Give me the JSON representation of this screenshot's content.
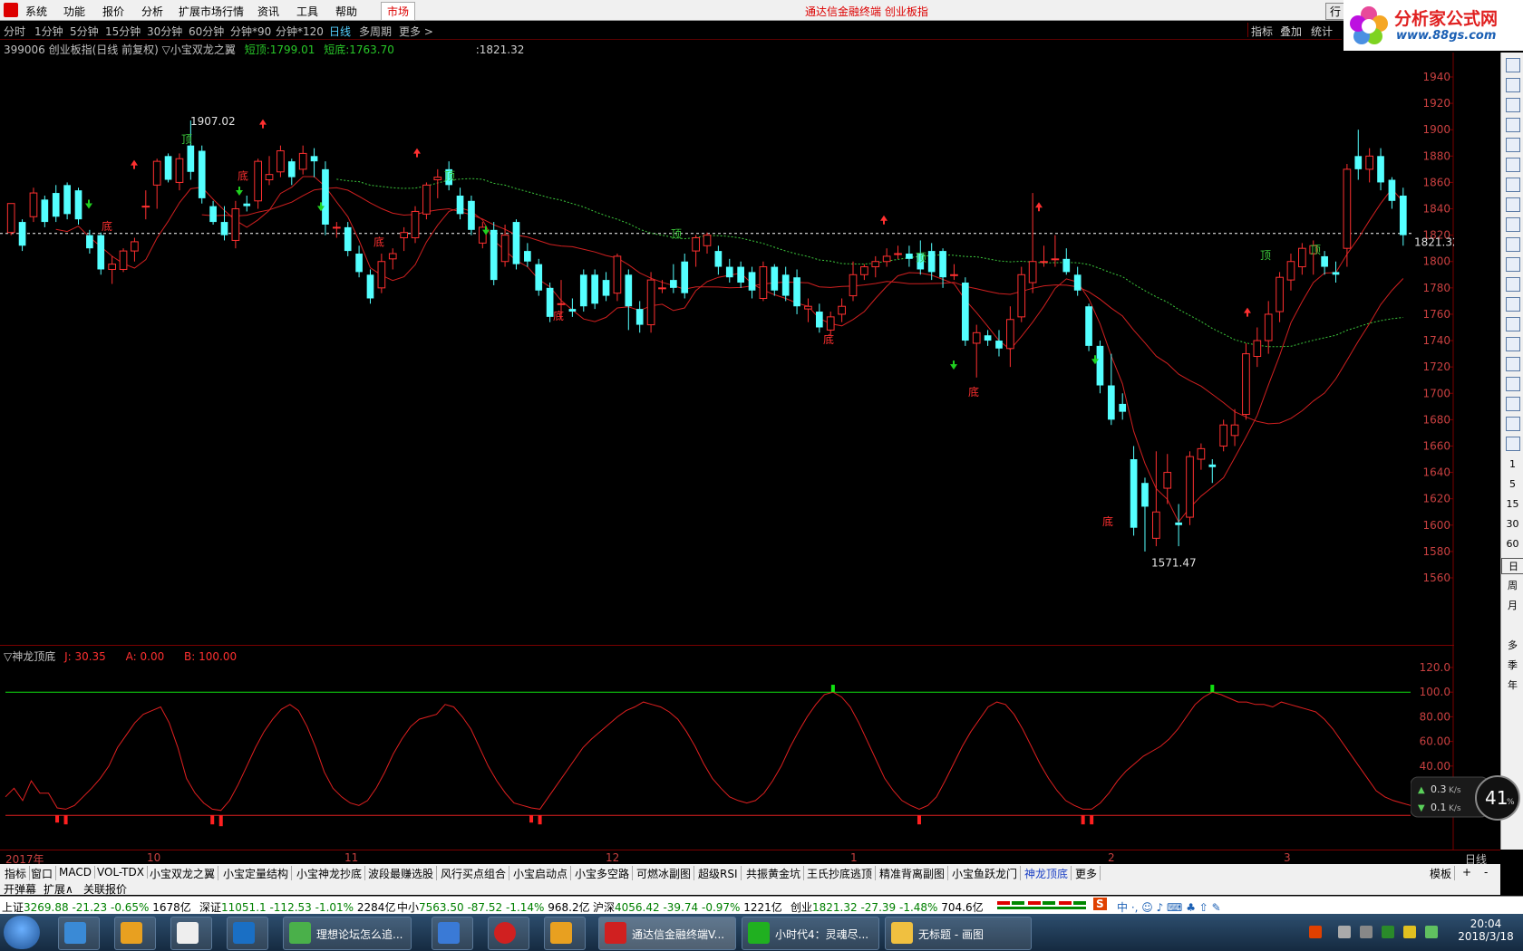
{
  "menubar": {
    "items": [
      "系统",
      "功能",
      "报价",
      "分析",
      "扩展市场行情",
      "资讯",
      "工具",
      "帮助"
    ],
    "market": "市场",
    "title": "通达信金融终端 创业板指",
    "quote_btn": "行"
  },
  "brand": {
    "name": "分析家公式网",
    "url": "www.88gs.com"
  },
  "periods": [
    "分时",
    "1分钟",
    "5分钟",
    "15分钟",
    "30分钟",
    "60分钟",
    "分钟*90",
    "分钟*120",
    "日线",
    "多周期",
    "更多 >"
  ],
  "active_period": "日线",
  "top_tools": [
    "指标",
    "叠加",
    "统计"
  ],
  "info": {
    "symbol": "399006 创业板指(日线 前复权) ▽小宝双龙之翼",
    "short_top_label": "短顶:",
    "short_top": "1799.01",
    "short_bottom_label": "短底:",
    "short_bottom": "1763.70",
    "cursor_value": ":1821.32"
  },
  "price_axis": {
    "ticks": [
      "1940",
      "1920",
      "1900",
      "1880",
      "1860",
      "1840",
      "1820",
      "1800",
      "1780",
      "1760",
      "1740",
      "1720",
      "1700",
      "1680",
      "1660",
      "1640",
      "1620",
      "1600",
      "1580",
      "1560"
    ],
    "current": "1821.32"
  },
  "annotations": {
    "high": "1907.02",
    "low": "1571.47",
    "top": "顶",
    "bottom": "底"
  },
  "indicator": {
    "name": "▽神龙顶底",
    "j": "J: 30.35",
    "a": "A: 0.00",
    "b": "B: 100.00",
    "ticks": [
      "120.0",
      "100.0",
      "80.00",
      "60.00",
      "40.00",
      "20.00"
    ]
  },
  "date_axis": {
    "labels": [
      "2017年",
      "10",
      "11",
      "12",
      "1",
      "2",
      "3"
    ],
    "period": "日线"
  },
  "indicator_tabs": [
    "指标",
    "窗口",
    "MACD",
    "VOL-TDX",
    "小宝双龙之翼",
    "小宝定量结构",
    "小宝神龙抄底",
    "波段最赚选股",
    "风行买点组合",
    "小宝启动点",
    "小宝多空路",
    "可燃冰副图",
    "超级RSI",
    "共振黄金坑",
    "王氏抄底逃顶",
    "精准背离副图",
    "小宝鱼跃龙门",
    "神龙顶底",
    "更多"
  ],
  "active_tab": "神龙顶底",
  "tabs_right": [
    "模板",
    "+",
    "-"
  ],
  "sub_tabs": [
    "开弹幕",
    "扩展∧",
    "关联报价"
  ],
  "right_tool_labels": [
    "1",
    "5",
    "15",
    "30",
    "60",
    "日",
    "周",
    "月",
    "多",
    "季",
    "年"
  ],
  "status": [
    {
      "name": "上证",
      "value": "3269.88",
      "chg": "-21.23",
      "pct": "-0.65%",
      "amt": "1678亿"
    },
    {
      "name": "深证",
      "value": "11051.1",
      "chg": "-112.53",
      "pct": "-1.01%",
      "amt": "2284亿"
    },
    {
      "name": "中小",
      "value": "7563.50",
      "chg": "-87.52",
      "pct": "-1.14%",
      "amt": "968.2亿"
    },
    {
      "name": "沪深",
      "value": "4056.42",
      "chg": "-39.74",
      "pct": "-0.97%",
      "amt": "1221亿"
    },
    {
      "name": "创业",
      "value": "1821.32",
      "chg": "-27.39",
      "pct": "-1.48%",
      "amt": "704.6亿"
    }
  ],
  "netspeed": {
    "up": "0.3",
    "down": "0.1",
    "unit": "K/s",
    "percent": "41",
    "sign": "%"
  },
  "taskbar": {
    "windows": [
      "理想论坛怎么追...",
      "通达信金融终端V...",
      "小时代4：灵魂尽...",
      "无标题 - 画图"
    ],
    "time": "20:04",
    "date": "2018/3/18"
  },
  "colors": {
    "up": "#ff3030",
    "down": "#54ffff",
    "ma": "#d02020",
    "dash": "#3cc83c",
    "kdj": "#e02020",
    "ref": "#10e010"
  },
  "chart_data": {
    "type": "candlestick",
    "ylim": [
      1550,
      1950
    ],
    "candles": [
      [
        1822,
        1844,
        1838,
        1820
      ],
      [
        1830,
        1812,
        1808,
        1832
      ],
      [
        1834,
        1852,
        1856,
        1830
      ],
      [
        1847,
        1830,
        1826,
        1850
      ],
      [
        1852,
        1834,
        1830,
        1858
      ],
      [
        1858,
        1836,
        1832,
        1860
      ],
      [
        1854,
        1832,
        1828,
        1856
      ],
      [
        1820,
        1810,
        1806,
        1824
      ],
      [
        1820,
        1794,
        1790,
        1822
      ],
      [
        1794,
        1798,
        1783,
        1804
      ],
      [
        1794,
        1808,
        1792,
        1810
      ],
      [
        1808,
        1815,
        1800,
        1818
      ],
      [
        1842,
        1842,
        1832,
        1854
      ],
      [
        1858,
        1876,
        1840,
        1878
      ],
      [
        1880,
        1862,
        1860,
        1882
      ],
      [
        1860,
        1878,
        1854,
        1882
      ],
      [
        1888,
        1868,
        1862,
        1907
      ],
      [
        1884,
        1848,
        1844,
        1888
      ],
      [
        1842,
        1830,
        1828,
        1846
      ],
      [
        1830,
        1820,
        1816,
        1842
      ],
      [
        1816,
        1840,
        1810,
        1846
      ],
      [
        1844,
        1842,
        1838,
        1850
      ],
      [
        1846,
        1876,
        1840,
        1878
      ],
      [
        1862,
        1866,
        1858,
        1880
      ],
      [
        1868,
        1884,
        1864,
        1888
      ],
      [
        1876,
        1864,
        1858,
        1878
      ],
      [
        1870,
        1882,
        1866,
        1888
      ],
      [
        1880,
        1876,
        1864,
        1886
      ],
      [
        1870,
        1828,
        1820,
        1876
      ],
      [
        1826,
        1826,
        1818,
        1830
      ],
      [
        1826,
        1808,
        1804,
        1830
      ],
      [
        1806,
        1792,
        1788,
        1812
      ],
      [
        1790,
        1772,
        1768,
        1794
      ],
      [
        1780,
        1800,
        1776,
        1806
      ],
      [
        1802,
        1806,
        1794,
        1810
      ],
      [
        1818,
        1822,
        1808,
        1826
      ],
      [
        1818,
        1838,
        1814,
        1842
      ],
      [
        1836,
        1858,
        1832,
        1860
      ],
      [
        1862,
        1864,
        1848,
        1870
      ],
      [
        1870,
        1858,
        1854,
        1876
      ],
      [
        1850,
        1836,
        1832,
        1856
      ],
      [
        1846,
        1824,
        1820,
        1850
      ],
      [
        1814,
        1826,
        1810,
        1830
      ],
      [
        1824,
        1786,
        1782,
        1830
      ],
      [
        1800,
        1820,
        1796,
        1828
      ],
      [
        1830,
        1798,
        1794,
        1832
      ],
      [
        1808,
        1800,
        1796,
        1814
      ],
      [
        1798,
        1778,
        1774,
        1802
      ],
      [
        1780,
        1758,
        1754,
        1784
      ],
      [
        1768,
        1768,
        1756,
        1786
      ],
      [
        1764,
        1762,
        1758,
        1772
      ],
      [
        1790,
        1766,
        1762,
        1794
      ],
      [
        1790,
        1768,
        1764,
        1794
      ],
      [
        1786,
        1774,
        1770,
        1792
      ],
      [
        1776,
        1804,
        1770,
        1806
      ],
      [
        1790,
        1766,
        1748,
        1794
      ],
      [
        1764,
        1752,
        1746,
        1770
      ],
      [
        1752,
        1786,
        1746,
        1792
      ],
      [
        1780,
        1780,
        1776,
        1786
      ],
      [
        1786,
        1780,
        1776,
        1798
      ],
      [
        1800,
        1776,
        1772,
        1806
      ],
      [
        1808,
        1818,
        1796,
        1820
      ],
      [
        1812,
        1820,
        1806,
        1822
      ],
      [
        1808,
        1796,
        1790,
        1812
      ],
      [
        1796,
        1788,
        1784,
        1802
      ],
      [
        1796,
        1784,
        1780,
        1800
      ],
      [
        1792,
        1778,
        1772,
        1796
      ],
      [
        1772,
        1796,
        1770,
        1800
      ],
      [
        1796,
        1778,
        1774,
        1798
      ],
      [
        1790,
        1774,
        1770,
        1796
      ],
      [
        1788,
        1766,
        1760,
        1794
      ],
      [
        1764,
        1766,
        1754,
        1772
      ],
      [
        1762,
        1750,
        1746,
        1768
      ],
      [
        1748,
        1758,
        1744,
        1762
      ],
      [
        1760,
        1766,
        1754,
        1772
      ],
      [
        1774,
        1790,
        1770,
        1800
      ],
      [
        1790,
        1796,
        1786,
        1798
      ],
      [
        1796,
        1800,
        1788,
        1804
      ],
      [
        1800,
        1804,
        1796,
        1810
      ],
      [
        1806,
        1806,
        1802,
        1812
      ],
      [
        1806,
        1802,
        1796,
        1812
      ],
      [
        1806,
        1794,
        1790,
        1816
      ],
      [
        1808,
        1792,
        1786,
        1814
      ],
      [
        1808,
        1788,
        1780,
        1810
      ],
      [
        1790,
        1790,
        1786,
        1798
      ],
      [
        1784,
        1740,
        1736,
        1788
      ],
      [
        1738,
        1746,
        1712,
        1752
      ],
      [
        1744,
        1740,
        1736,
        1748
      ],
      [
        1740,
        1734,
        1728,
        1748
      ],
      [
        1734,
        1756,
        1720,
        1766
      ],
      [
        1758,
        1790,
        1754,
        1796
      ],
      [
        1784,
        1800,
        1776,
        1852
      ],
      [
        1800,
        1800,
        1796,
        1812
      ],
      [
        1802,
        1802,
        1796,
        1820
      ],
      [
        1802,
        1792,
        1790,
        1810
      ],
      [
        1790,
        1778,
        1774,
        1796
      ],
      [
        1766,
        1736,
        1732,
        1768
      ],
      [
        1736,
        1706,
        1700,
        1740
      ],
      [
        1706,
        1680,
        1676,
        1730
      ],
      [
        1692,
        1686,
        1680,
        1700
      ],
      [
        1650,
        1598,
        1592,
        1660
      ],
      [
        1632,
        1614,
        1580,
        1636
      ],
      [
        1590,
        1610,
        1584,
        1656
      ],
      [
        1628,
        1640,
        1616,
        1654
      ],
      [
        1602,
        1600,
        1584,
        1616
      ],
      [
        1606,
        1652,
        1600,
        1656
      ],
      [
        1650,
        1658,
        1642,
        1662
      ],
      [
        1646,
        1644,
        1632,
        1650
      ],
      [
        1660,
        1676,
        1656,
        1680
      ],
      [
        1668,
        1676,
        1660,
        1688
      ],
      [
        1684,
        1730,
        1680,
        1738
      ],
      [
        1728,
        1740,
        1720,
        1750
      ],
      [
        1740,
        1760,
        1730,
        1770
      ],
      [
        1762,
        1788,
        1754,
        1792
      ],
      [
        1786,
        1800,
        1778,
        1806
      ],
      [
        1796,
        1810,
        1790,
        1814
      ],
      [
        1806,
        1812,
        1790,
        1816
      ],
      [
        1804,
        1796,
        1790,
        1808
      ],
      [
        1792,
        1790,
        1784,
        1800
      ],
      [
        1810,
        1870,
        1796,
        1874
      ],
      [
        1880,
        1870,
        1862,
        1900
      ],
      [
        1870,
        1880,
        1860,
        1886
      ],
      [
        1880,
        1860,
        1854,
        1886
      ],
      [
        1862,
        1846,
        1840,
        1864
      ],
      [
        1850,
        1820,
        1812,
        1856
      ]
    ],
    "kdj": [
      15,
      22,
      12,
      28,
      18,
      18,
      6,
      5,
      8,
      15,
      22,
      30,
      40,
      55,
      65,
      75,
      82,
      85,
      88,
      75,
      55,
      30,
      18,
      10,
      5,
      4,
      12,
      25,
      40,
      55,
      68,
      78,
      86,
      90,
      85,
      72,
      55,
      35,
      22,
      15,
      10,
      8,
      12,
      22,
      35,
      50,
      62,
      72,
      78,
      80,
      82,
      90,
      88,
      80,
      70,
      55,
      40,
      28,
      18,
      10,
      8,
      6,
      5,
      15,
      25,
      35,
      45,
      55,
      62,
      68,
      74,
      80,
      85,
      88,
      92,
      90,
      88,
      84,
      78,
      68,
      56,
      42,
      30,
      22,
      15,
      12,
      10,
      12,
      18,
      28,
      40,
      55,
      68,
      80,
      90,
      98,
      100,
      96,
      88,
      75,
      60,
      45,
      30,
      20,
      12,
      8,
      5,
      8,
      15,
      28,
      42,
      56,
      68,
      78,
      88,
      92,
      90,
      82,
      70,
      56,
      42,
      30,
      20,
      12,
      8,
      5,
      5,
      10,
      18,
      28,
      36,
      42,
      48,
      52,
      56,
      62,
      70,
      80,
      90,
      96,
      100,
      98,
      95,
      92,
      92,
      90,
      90,
      88,
      92,
      90,
      88,
      86,
      84,
      78,
      70,
      60,
      50,
      40,
      30,
      20,
      15,
      12,
      10,
      8
    ]
  }
}
